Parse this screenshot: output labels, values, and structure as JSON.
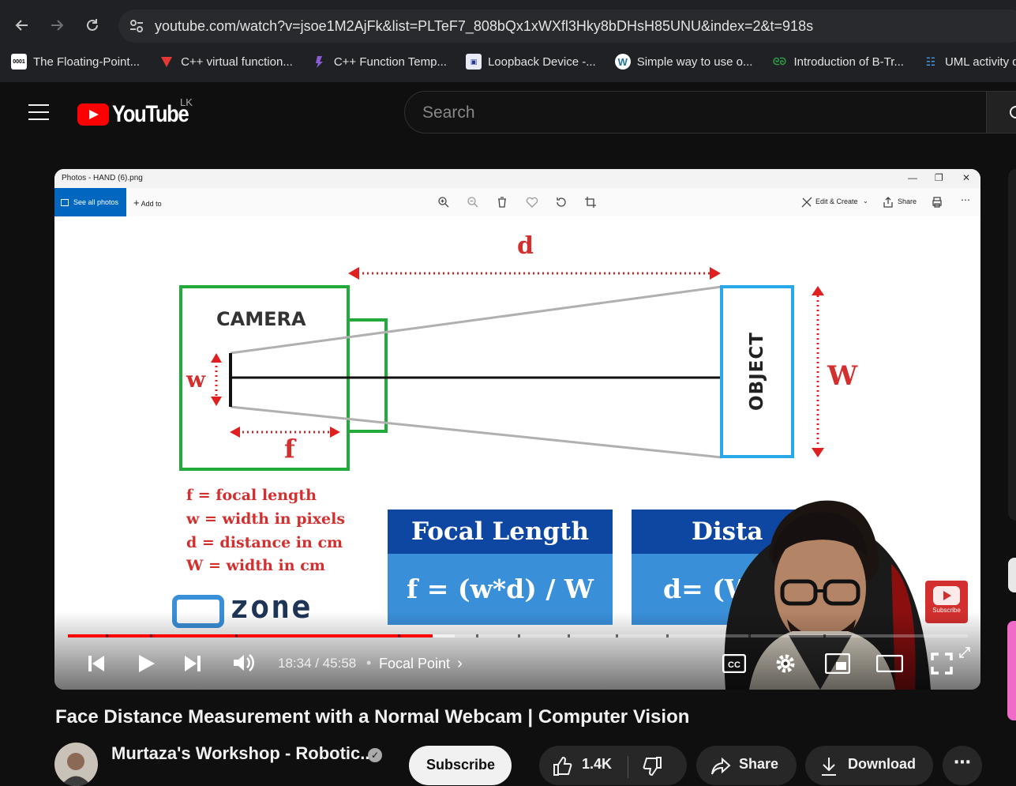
{
  "browser": {
    "url": "youtube.com/watch?v=jsoe1M2AjFk&list=PLTeF7_808bQx1xWXfl3Hky8bDHsH85UNU&index=2&t=918s",
    "bookmarks": [
      {
        "label": "The Floating-Point...",
        "icon": "floating-point-favicon",
        "color": "#ffffff"
      },
      {
        "label": "C++ virtual function...",
        "icon": "tutorialspoint-favicon",
        "color": "#e53935"
      },
      {
        "label": "C++ Function Temp...",
        "icon": "programiz-favicon",
        "color": "#7e57c2"
      },
      {
        "label": "Loopback Device -...",
        "icon": "loopback-favicon",
        "color": "#3f51b5"
      },
      {
        "label": "Simple way to use o...",
        "icon": "wordpress-favicon",
        "color": "#ffffff"
      },
      {
        "label": "Introduction of B-Tr...",
        "icon": "geeksforgeeks-favicon",
        "color": "#2e7d32"
      },
      {
        "label": "UML activity d",
        "icon": "uml-favicon",
        "color": "#1e88e5"
      }
    ]
  },
  "youtube": {
    "logo_text": "YouTube",
    "country_code": "LK",
    "search_placeholder": "Search"
  },
  "photos_app": {
    "window_title": "Photos - HAND (6).png",
    "see_all_photos": "See all photos",
    "add_to": "Add to",
    "edit_create": "Edit & Create",
    "share": "Share"
  },
  "diagram": {
    "d_label": "d",
    "camera_label": "CAMERA",
    "w_small_label": "w",
    "f_label": "f",
    "object_label": "OBJECT",
    "W_big_label": "W",
    "legend": [
      "f = focal length",
      "w = width in pixels",
      "d = distance in cm",
      "W = width in cm"
    ],
    "focal_box": {
      "title": "Focal Length",
      "formula": "f = (w*d) / W"
    },
    "distance_box": {
      "title": "Dista",
      "formula": "d= (W*"
    },
    "cvzone_text": "zone",
    "colors": {
      "camera": "#22aa3a",
      "object": "#29a8e8",
      "red": "#e02020",
      "dark_blue": "#0d47a1",
      "light_blue": "#3a8fd9"
    }
  },
  "player": {
    "time": "18:34 / 45:58",
    "chapter": "Focal Point",
    "progress_played_fraction": 0.405,
    "progress_buffered_fraction": 0.43,
    "subscribe_watermark": "Subscribe"
  },
  "video": {
    "title": "Face Distance Measurement with a Normal Webcam | Computer Vision",
    "channel": "Murtaza's Workshop - Robotic...",
    "subscribe": "Subscribe",
    "likes": "1.4K",
    "share": "Share",
    "download": "Download"
  }
}
